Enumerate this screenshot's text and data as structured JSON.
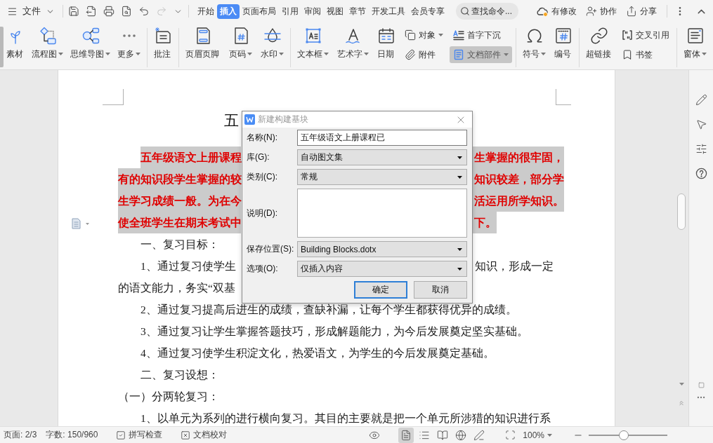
{
  "menu": {
    "label": "文件"
  },
  "quick_access": [
    {
      "disabled": false
    },
    {
      "disabled": false
    },
    {
      "disabled": false
    },
    {
      "disabled": false
    },
    {
      "disabled": false
    },
    {
      "disabled": true
    },
    {
      "disabled": false
    }
  ],
  "tabs": [
    {
      "label": "开始",
      "selected": false
    },
    {
      "label": "插入",
      "selected": true
    },
    {
      "label": "页面布局",
      "selected": false
    },
    {
      "label": "引用",
      "selected": false
    },
    {
      "label": "审阅",
      "selected": false
    },
    {
      "label": "视图",
      "selected": false
    },
    {
      "label": "章节",
      "selected": false
    },
    {
      "label": "开发工具",
      "selected": false
    },
    {
      "label": "会员专享",
      "selected": false
    }
  ],
  "search": {
    "placeholder": "查找命令..."
  },
  "actions": [
    {
      "label": "有修改"
    },
    {
      "label": "协作"
    },
    {
      "label": "分享"
    }
  ],
  "ribbon": {
    "groups": [
      {
        "items": [
          {
            "kind": "large",
            "label": "素材",
            "dropdown": false,
            "pressed": false
          },
          {
            "kind": "large",
            "label": "流程图",
            "dropdown": true,
            "pressed": false
          },
          {
            "kind": "large",
            "label": "思维导图",
            "dropdown": true,
            "pressed": false
          },
          {
            "kind": "large",
            "label": "更多",
            "dropdown": true,
            "pressed": false
          }
        ]
      },
      {
        "items": [
          {
            "kind": "large",
            "label": "批注",
            "dropdown": false,
            "pressed": false
          }
        ]
      },
      {
        "items": [
          {
            "kind": "large",
            "label": "页眉页脚",
            "dropdown": false,
            "pressed": false
          },
          {
            "kind": "large",
            "label": "页码",
            "dropdown": true,
            "pressed": false
          },
          {
            "kind": "large",
            "label": "水印",
            "dropdown": true,
            "pressed": false
          }
        ]
      },
      {
        "items": [
          {
            "kind": "large",
            "label": "文本框",
            "dropdown": true,
            "pressed": false
          },
          {
            "kind": "large",
            "label": "艺术字",
            "dropdown": true,
            "pressed": false
          },
          {
            "kind": "large",
            "label": "日期",
            "dropdown": false,
            "pressed": false
          },
          {
            "kind": "stack",
            "items": [
              {
                "label": "对象",
                "dropdown": true,
                "pressed": false
              },
              {
                "label": "附件",
                "dropdown": false,
                "pressed": false
              }
            ]
          },
          {
            "kind": "stack",
            "items": [
              {
                "label": "首字下沉",
                "dropdown": false,
                "pressed": false
              },
              {
                "label": "文档部件",
                "dropdown": true,
                "pressed": true
              }
            ]
          }
        ]
      },
      {
        "items": [
          {
            "kind": "large",
            "label": "符号",
            "dropdown": true,
            "pressed": false
          },
          {
            "kind": "large",
            "label": "编号",
            "dropdown": false,
            "pressed": false
          }
        ]
      },
      {
        "items": [
          {
            "kind": "large",
            "label": "超链接",
            "dropdown": false,
            "pressed": false
          },
          {
            "kind": "stack",
            "items": [
              {
                "label": "交叉引用",
                "dropdown": false,
                "pressed": false
              },
              {
                "label": "书签",
                "dropdown": false,
                "pressed": false
              }
            ]
          }
        ]
      },
      {
        "items": [
          {
            "kind": "large",
            "label": "窗体",
            "dropdown": true,
            "pressed": false
          }
        ]
      }
    ]
  },
  "document": {
    "title": "五",
    "paragraphs": [
      {
        "kind": "indented",
        "highlighted": true,
        "lines": [
          [
            "五年级语文上册课程",
            "生掌握的很牢固，"
          ],
          [
            "有的知识段学生掌握的较",
            "知识较差，部分学"
          ],
          [
            "生学习成绩一般。为在今",
            "活运用所学知识。"
          ],
          [
            "使全班学生在期末考试中",
            "下。"
          ]
        ]
      },
      {
        "kind": "indented",
        "highlighted": false,
        "lines": [
          [
            "一、复习目标："
          ]
        ]
      },
      {
        "kind": "indented",
        "highlighted": false,
        "lines": [
          [
            "1、通过复习使学生",
            "知识，形成一定"
          ],
          [
            "的语文能力，务实“双基"
          ]
        ]
      },
      {
        "kind": "indented",
        "highlighted": false,
        "lines": [
          [
            "2、通过复习提高后进生的成绩，查缺补漏，让每个学生都获得优异的成绩。"
          ]
        ]
      },
      {
        "kind": "indented",
        "highlighted": false,
        "lines": [
          [
            "3、通过复习让学生掌握答题技巧，形成解题能力，为今后发展奠定坚实基础。"
          ]
        ]
      },
      {
        "kind": "indented",
        "highlighted": false,
        "lines": [
          [
            "4、通过复习使学生积淀文化，热爱语文，为学生的今后发展奠定基础。"
          ]
        ]
      },
      {
        "kind": "indented",
        "highlighted": false,
        "lines": [
          [
            "二、复习设想："
          ]
        ]
      },
      {
        "kind": "flush",
        "highlighted": false,
        "lines": [
          [
            "（一）分两轮复习："
          ]
        ]
      },
      {
        "kind": "indented",
        "highlighted": false,
        "lines": [
          [
            "1、以单元为系列的进行横向复习。其目的主要就是把一个单元所涉猎的知识进行系"
          ]
        ]
      }
    ]
  },
  "dialog": {
    "title": "新建构建基块",
    "fields": [
      {
        "kind": "text",
        "label": "名称(N):",
        "value": "五年级语文上册课程已"
      },
      {
        "kind": "select",
        "label": "库(G):",
        "value": "自动图文集"
      },
      {
        "kind": "select",
        "label": "类别(C):",
        "value": "常规"
      },
      {
        "kind": "textarea",
        "label": "说明(D):"
      },
      {
        "kind": "select",
        "label": "保存位置(S):",
        "value": "Building Blocks.dotx"
      },
      {
        "kind": "select",
        "label": "选项(O):",
        "value": "仅插入内容"
      }
    ],
    "buttons": [
      {
        "label": "确定",
        "default": true
      },
      {
        "label": "取消",
        "default": false
      }
    ]
  },
  "status_bar": {
    "page": "页面: 2/3",
    "words": "字数: 150/960",
    "tools": [
      {
        "label": "拼写检查"
      },
      {
        "label": "文档校对"
      }
    ],
    "views": [
      {
        "selected": true
      },
      {
        "selected": false
      },
      {
        "selected": false
      },
      {
        "selected": false
      },
      {
        "selected": false
      }
    ],
    "zoom": "100%",
    "zoom_slider": {
      "level": 0.45
    }
  }
}
